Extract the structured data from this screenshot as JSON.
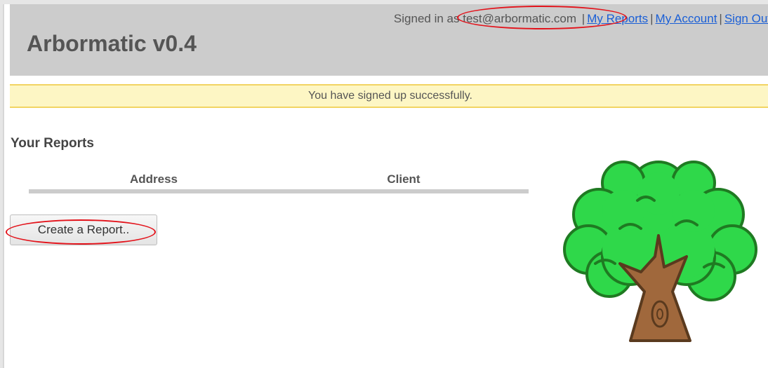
{
  "header": {
    "title": "Arbormatic v0.4",
    "signed_in_prefix": "Signed in as",
    "user_email": "test@arbormatic.com",
    "separator": "|",
    "links": {
      "my_reports": "My Reports",
      "my_account": "My Account",
      "sign_out": "Sign Out"
    }
  },
  "flash": {
    "message": "You have signed up successfully."
  },
  "reports": {
    "heading": "Your Reports",
    "columns": [
      "Address",
      "Client"
    ],
    "rows": [],
    "create_button_label": "Create a Report.."
  },
  "colors": {
    "header_bg": "#cccccc",
    "flash_bg": "#fdf6c4",
    "flash_border": "#f2d462",
    "link": "#1a5fd6",
    "annotation": "#e3131b"
  },
  "icons": {
    "mascot": "tree-icon"
  }
}
